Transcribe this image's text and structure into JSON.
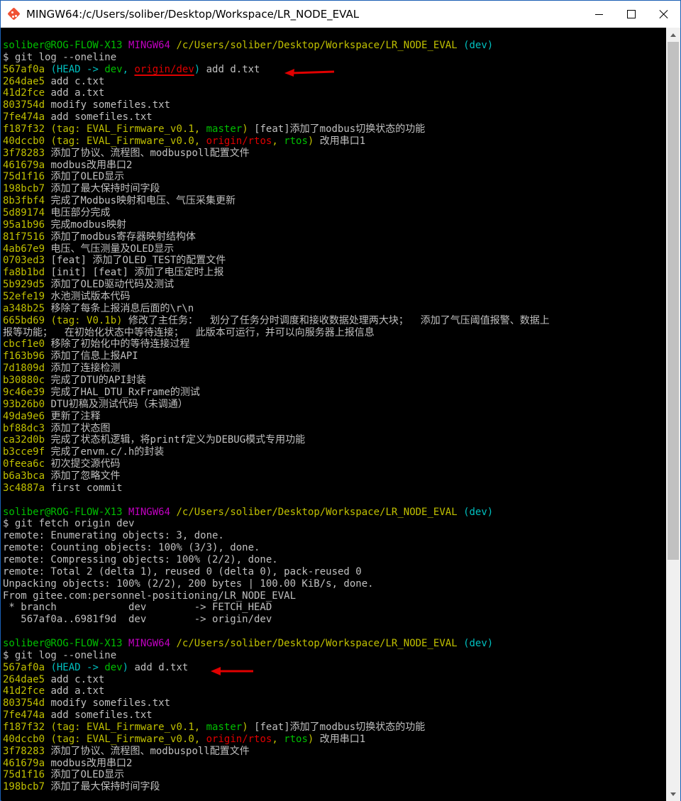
{
  "window": {
    "title": "MINGW64:/c/Users/soliber/Desktop/Workspace/LR_NODE_EVAL",
    "icon": "git-bash-icon",
    "controls": [
      "minimize",
      "maximize",
      "close"
    ]
  },
  "colors": {
    "annotation_arrow": "#e00000",
    "hash": "#c0c000",
    "prompt_user": "#00c000",
    "prompt_system": "#c000c0",
    "path": "#c0c000",
    "branch": "#00c0c0"
  },
  "terminal": {
    "lines": [
      [
        [
          "soliber@ROG-FLOW-X13",
          "g"
        ],
        [
          " ",
          "w"
        ],
        [
          "MINGW64",
          "m"
        ],
        [
          " ",
          "w"
        ],
        [
          "/c/Users/soliber/Desktop/Workspace/LR_NODE_EVAL",
          "y"
        ],
        [
          " ",
          "w"
        ],
        [
          "(dev)",
          "c"
        ]
      ],
      [
        [
          "$ git log --oneline",
          "w"
        ]
      ],
      [
        [
          "567af0a",
          "hash"
        ],
        [
          " ",
          "w"
        ],
        [
          "(HEAD -> ",
          "c"
        ],
        [
          "dev",
          "g"
        ],
        [
          ", ",
          "c"
        ],
        [
          "origin/dev",
          "r ul"
        ],
        [
          ")",
          "c"
        ],
        [
          " add d.txt",
          "w"
        ]
      ],
      [
        [
          "264dae5",
          "hash"
        ],
        [
          " add c.txt",
          "w"
        ]
      ],
      [
        [
          "41d2fce",
          "hash"
        ],
        [
          " add a.txt",
          "w"
        ]
      ],
      [
        [
          "803754d",
          "hash"
        ],
        [
          " modify somefiles.txt",
          "w"
        ]
      ],
      [
        [
          "7fe474a",
          "hash"
        ],
        [
          " add somefiles.txt",
          "w"
        ]
      ],
      [
        [
          "f187f32",
          "hash"
        ],
        [
          " ",
          "w"
        ],
        [
          "(",
          "y"
        ],
        [
          "tag: EVAL_Firmware_v0.1",
          "y"
        ],
        [
          ", ",
          "y"
        ],
        [
          "master",
          "g"
        ],
        [
          ")",
          "y"
        ],
        [
          " [feat]添加了modbus切换状态的功能",
          "w"
        ]
      ],
      [
        [
          "40dccb0",
          "hash"
        ],
        [
          " ",
          "w"
        ],
        [
          "(",
          "y"
        ],
        [
          "tag: EVAL_Firmware_v0.0",
          "y"
        ],
        [
          ", ",
          "y"
        ],
        [
          "origin/rtos",
          "r"
        ],
        [
          ", ",
          "y"
        ],
        [
          "rtos",
          "g"
        ],
        [
          ")",
          "y"
        ],
        [
          " 改用串口1",
          "w"
        ]
      ],
      [
        [
          "3f78283",
          "hash"
        ],
        [
          " 添加了协议、流程图、modbuspoll配置文件",
          "w"
        ]
      ],
      [
        [
          "461679a",
          "hash"
        ],
        [
          " modbus改用串口2",
          "w"
        ]
      ],
      [
        [
          "75d1f16",
          "hash"
        ],
        [
          " 添加了OLED显示",
          "w"
        ]
      ],
      [
        [
          "198bcb7",
          "hash"
        ],
        [
          " 添加了最大保持时间字段",
          "w"
        ]
      ],
      [
        [
          "8b3fbf4",
          "hash"
        ],
        [
          " 完成了Modbus映射和电压、气压采集更新",
          "w"
        ]
      ],
      [
        [
          "5d89174",
          "hash"
        ],
        [
          " 电压部分完成",
          "w"
        ]
      ],
      [
        [
          "95a1b96",
          "hash"
        ],
        [
          " 完成modbus映射",
          "w"
        ]
      ],
      [
        [
          "81f7516",
          "hash"
        ],
        [
          " 添加了modbus寄存器映射结构体",
          "w"
        ]
      ],
      [
        [
          "4ab67e9",
          "hash"
        ],
        [
          " 电压、气压测量及OLED显示",
          "w"
        ]
      ],
      [
        [
          "0703ed3",
          "hash"
        ],
        [
          " [feat] 添加了OLED_TEST的配置文件",
          "w"
        ]
      ],
      [
        [
          "fa8b1bd",
          "hash"
        ],
        [
          " [init] [feat] 添加了电压定时上报",
          "w"
        ]
      ],
      [
        [
          "5b929d5",
          "hash"
        ],
        [
          " 添加了OLED驱动代码及测试",
          "w"
        ]
      ],
      [
        [
          "52efe19",
          "hash"
        ],
        [
          " 水池测试版本代码",
          "w"
        ]
      ],
      [
        [
          "a348b25",
          "hash"
        ],
        [
          " 移除了每条上报消息后面的\\r\\n",
          "w"
        ]
      ],
      [
        [
          "665bd69",
          "hash"
        ],
        [
          " ",
          "w"
        ],
        [
          "(tag: V0.1b)",
          "y"
        ],
        [
          " 修改了主任务：  划分了任务分时调度和接收数据处理两大块；  添加了气压阈值报警、数据上",
          "w"
        ]
      ],
      [
        [
          "报等功能；  在初始化状态中等待连接；  此版本可运行，并可以向服务器上报信息",
          "w"
        ]
      ],
      [
        [
          "cbcf1e0",
          "hash"
        ],
        [
          " 移除了初始化中的等待连接过程",
          "w"
        ]
      ],
      [
        [
          "f163b96",
          "hash"
        ],
        [
          " 添加了信息上报API",
          "w"
        ]
      ],
      [
        [
          "7d1809d",
          "hash"
        ],
        [
          " 添加了连接检测",
          "w"
        ]
      ],
      [
        [
          "b30880c",
          "hash"
        ],
        [
          " 完成了DTU的API封装",
          "w"
        ]
      ],
      [
        [
          "9c46e39",
          "hash"
        ],
        [
          " 完成了HAL_DTU_RxFrame的测试",
          "w"
        ]
      ],
      [
        [
          "93b26b0",
          "hash"
        ],
        [
          " DTU初稿及测试代码（未调通）",
          "w"
        ]
      ],
      [
        [
          "49da9e6",
          "hash"
        ],
        [
          " 更新了注释",
          "w"
        ]
      ],
      [
        [
          "bf88dc3",
          "hash"
        ],
        [
          " 添加了状态图",
          "w"
        ]
      ],
      [
        [
          "ca32d0b",
          "hash"
        ],
        [
          " 完成了状态机逻辑，将printf定义为DEBUG模式专用功能",
          "w"
        ]
      ],
      [
        [
          "b3cce9f",
          "hash"
        ],
        [
          " 完成了envm.c/.h的封装",
          "w"
        ]
      ],
      [
        [
          "0feea6c",
          "hash"
        ],
        [
          " 初次提交源代码",
          "w"
        ]
      ],
      [
        [
          "b6a3bca",
          "hash"
        ],
        [
          " 添加了忽略文件",
          "w"
        ]
      ],
      [
        [
          "3c4887a",
          "hash"
        ],
        [
          " first commit",
          "w"
        ]
      ],
      [
        [
          "",
          "w"
        ]
      ],
      [
        [
          "soliber@ROG-FLOW-X13",
          "g"
        ],
        [
          " ",
          "w"
        ],
        [
          "MINGW64",
          "m"
        ],
        [
          " ",
          "w"
        ],
        [
          "/c/Users/soliber/Desktop/Workspace/LR_NODE_EVAL",
          "y"
        ],
        [
          " ",
          "w"
        ],
        [
          "(dev)",
          "c"
        ]
      ],
      [
        [
          "$ git fetch origin dev",
          "w"
        ]
      ],
      [
        [
          "remote: Enumerating objects: 3, done.",
          "w"
        ]
      ],
      [
        [
          "remote: Counting objects: 100% (3/3), done.",
          "w"
        ]
      ],
      [
        [
          "remote: Compressing objects: 100% (2/2), done.",
          "w"
        ]
      ],
      [
        [
          "remote: Total 2 (delta 1), reused 0 (delta 0), pack-reused 0",
          "w"
        ]
      ],
      [
        [
          "Unpacking objects: 100% (2/2), 200 bytes | 100.00 KiB/s, done.",
          "w"
        ]
      ],
      [
        [
          "From gitee.com:personnel-positioning/LR_NODE_EVAL",
          "w"
        ]
      ],
      [
        [
          " * branch            dev        -> FETCH_HEAD",
          "w"
        ]
      ],
      [
        [
          "   567af0a..6981f9d  dev        -> origin/dev",
          "w"
        ]
      ],
      [
        [
          "",
          "w"
        ]
      ],
      [
        [
          "soliber@ROG-FLOW-X13",
          "g"
        ],
        [
          " ",
          "w"
        ],
        [
          "MINGW64",
          "m"
        ],
        [
          " ",
          "w"
        ],
        [
          "/c/Users/soliber/Desktop/Workspace/LR_NODE_EVAL",
          "y"
        ],
        [
          " ",
          "w"
        ],
        [
          "(dev)",
          "c"
        ]
      ],
      [
        [
          "$ git log --oneline",
          "w"
        ]
      ],
      [
        [
          "567af0a",
          "hash"
        ],
        [
          " ",
          "w"
        ],
        [
          "(HEAD -> ",
          "c"
        ],
        [
          "dev",
          "g"
        ],
        [
          ")",
          "c"
        ],
        [
          " add d.txt",
          "w"
        ]
      ],
      [
        [
          "264dae5",
          "hash"
        ],
        [
          " add c.txt",
          "w"
        ]
      ],
      [
        [
          "41d2fce",
          "hash"
        ],
        [
          " add a.txt",
          "w"
        ]
      ],
      [
        [
          "803754d",
          "hash"
        ],
        [
          " modify somefiles.txt",
          "w"
        ]
      ],
      [
        [
          "7fe474a",
          "hash"
        ],
        [
          " add somefiles.txt",
          "w"
        ]
      ],
      [
        [
          "f187f32",
          "hash"
        ],
        [
          " ",
          "w"
        ],
        [
          "(",
          "y"
        ],
        [
          "tag: EVAL_Firmware_v0.1",
          "y"
        ],
        [
          ", ",
          "y"
        ],
        [
          "master",
          "g"
        ],
        [
          ")",
          "y"
        ],
        [
          " [feat]添加了modbus切换状态的功能",
          "w"
        ]
      ],
      [
        [
          "40dccb0",
          "hash"
        ],
        [
          " ",
          "w"
        ],
        [
          "(",
          "y"
        ],
        [
          "tag: EVAL_Firmware_v0.0",
          "y"
        ],
        [
          ", ",
          "y"
        ],
        [
          "origin/rtos",
          "r"
        ],
        [
          ", ",
          "y"
        ],
        [
          "rtos",
          "g"
        ],
        [
          ")",
          "y"
        ],
        [
          " 改用串口1",
          "w"
        ]
      ],
      [
        [
          "3f78283",
          "hash"
        ],
        [
          " 添加了协议、流程图、modbuspoll配置文件",
          "w"
        ]
      ],
      [
        [
          "461679a",
          "hash"
        ],
        [
          " modbus改用串口2",
          "w"
        ]
      ],
      [
        [
          "75d1f16",
          "hash"
        ],
        [
          " 添加了OLED显示",
          "w"
        ]
      ],
      [
        [
          "198bcb7",
          "hash"
        ],
        [
          " 添加了最大保持时间字段",
          "w"
        ]
      ]
    ]
  }
}
